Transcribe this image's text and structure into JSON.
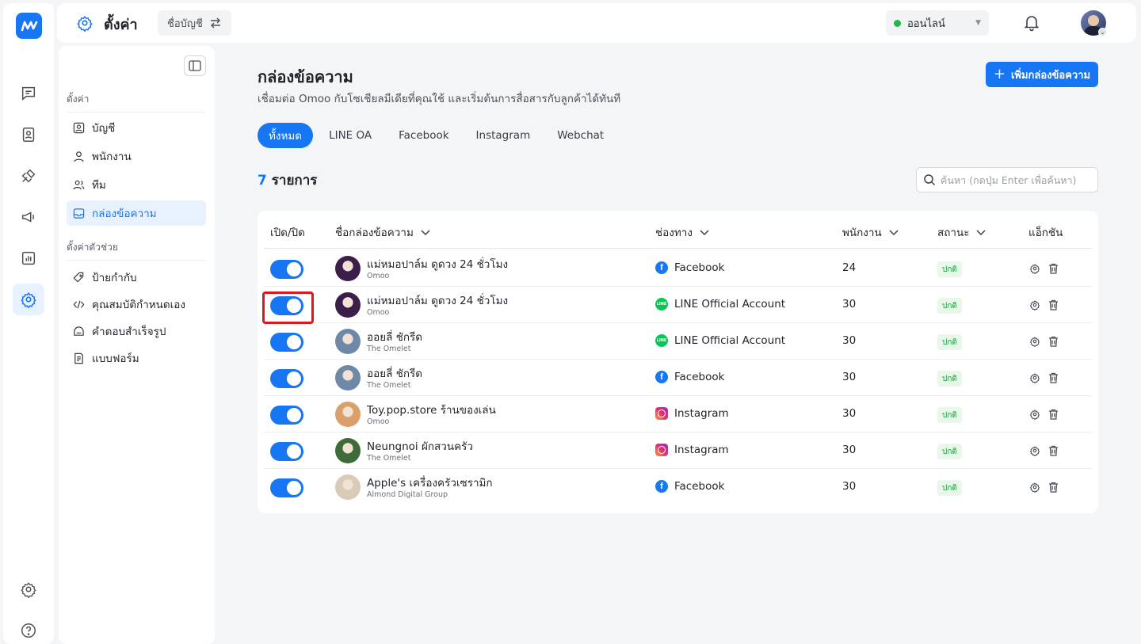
{
  "topbar": {
    "title": "ตั้งค่า",
    "account_label": "ชื่อบัญชี",
    "status": "ออนไลน์"
  },
  "side": {
    "section_settings": "ตั้งค่า",
    "section_helpers": "ตั้งค่าตัวช่วย",
    "items": [
      {
        "label": "บัญชี",
        "icon": "account-icon"
      },
      {
        "label": "พนักงาน",
        "icon": "user-icon"
      },
      {
        "label": "ทีม",
        "icon": "team-icon"
      },
      {
        "label": "กล่องข้อความ",
        "icon": "inbox-icon",
        "active": true
      }
    ],
    "helper_items": [
      {
        "label": "ป้ายกำกับ",
        "icon": "tag-icon"
      },
      {
        "label": "คุณสมบัติกำหนดเอง",
        "icon": "code-icon"
      },
      {
        "label": "คำตอบสำเร็จรูป",
        "icon": "quick-reply-icon"
      },
      {
        "label": "แบบฟอร์ม",
        "icon": "form-icon"
      }
    ]
  },
  "main": {
    "title": "กล่องข้อความ",
    "subtitle": "เชื่อมต่อ Omoo กับโซเชียลมีเดียที่คุณใช้ และเริ่มต้นการสื่อสารกับลูกค้าได้ทันที",
    "add_button": "เพิ่มกล่องข้อความ",
    "tabs": [
      "ทั้งหมด",
      "LINE OA",
      "Facebook",
      "Instagram",
      "Webchat"
    ],
    "count": "7",
    "count_label": "รายการ",
    "search_placeholder": "ค้นหา (กดปุ่ม Enter เพื่อค้นหา)",
    "columns": [
      "เปิด/ปิด",
      "ชื่อกล่องข้อความ",
      "ช่องทาง",
      "พนักงาน",
      "สถานะ",
      "แอ็กชัน"
    ],
    "rows": [
      {
        "name": "แม่หมอปาล์ม ดูดวง 24 ชั่วโมง",
        "org": "Omoo",
        "channel": "Facebook",
        "channel_icon": "facebook-icon",
        "staff": "24",
        "status": "ปกติ",
        "enabled": true,
        "avatar_color": "#3b1f4a"
      },
      {
        "name": "แม่หมอปาล์ม ดูดวง 24 ชั่วโมง",
        "org": "Omoo",
        "channel": "LINE Official Account",
        "channel_icon": "line-icon",
        "staff": "30",
        "status": "ปกติ",
        "enabled": true,
        "avatar_color": "#3b1f4a"
      },
      {
        "name": "ออยลี่ ชักรีด",
        "org": "The Omelet",
        "channel": "LINE Official Account",
        "channel_icon": "line-icon",
        "staff": "30",
        "status": "ปกติ",
        "enabled": true,
        "avatar_color": "#6e88a8"
      },
      {
        "name": "ออยลี่ ชักรีด",
        "org": "The Omelet",
        "channel": "Facebook",
        "channel_icon": "facebook-icon",
        "staff": "30",
        "status": "ปกติ",
        "enabled": true,
        "avatar_color": "#6e88a8"
      },
      {
        "name": "Toy.pop.store ร้านของเล่น",
        "org": "Omoo",
        "channel": "Instagram",
        "channel_icon": "instagram-icon",
        "staff": "30",
        "status": "ปกติ",
        "enabled": true,
        "avatar_color": "#d9a06b"
      },
      {
        "name": "Neungnoi ผักสวนครัว",
        "org": "The Omelet",
        "channel": "Instagram",
        "channel_icon": "instagram-icon",
        "staff": "30",
        "status": "ปกติ",
        "enabled": true,
        "avatar_color": "#3f6b3a"
      },
      {
        "name": "Apple's เครื่องครัวเซรามิก",
        "org": "Almond Digital Group",
        "channel": "Facebook",
        "channel_icon": "facebook-icon",
        "staff": "30",
        "status": "ปกติ",
        "enabled": true,
        "avatar_color": "#d8cbb8"
      }
    ]
  },
  "colors": {
    "accent": "#1676f3",
    "status_ok_bg": "#e8f7ea",
    "status_ok_text": "#1f9b3f",
    "highlight": "#e3161c"
  }
}
